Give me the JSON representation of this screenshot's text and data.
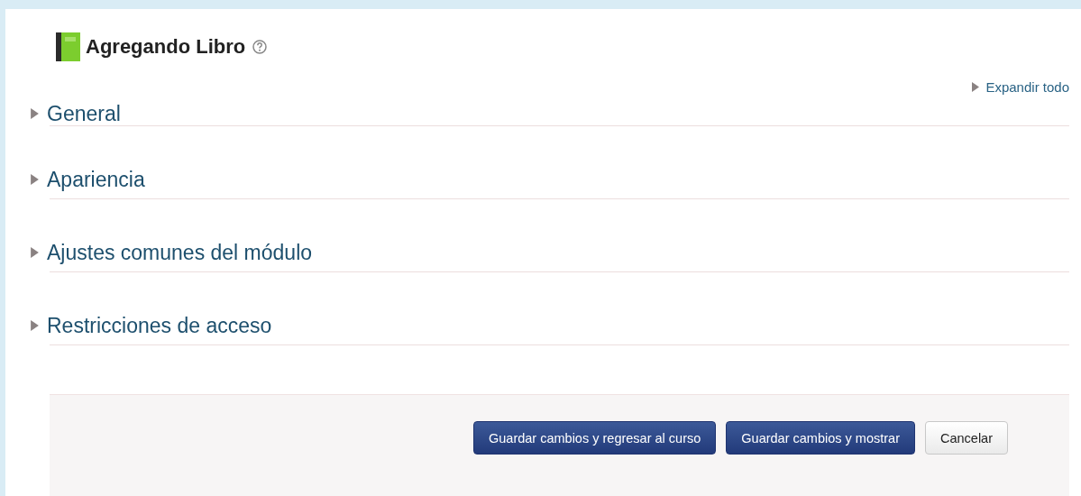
{
  "heading": {
    "title": "Agregando Libro"
  },
  "expand_all": {
    "label": "Expandir todo"
  },
  "sections": [
    {
      "title": "General",
      "expanded": false
    },
    {
      "title": "Apariencia",
      "expanded": false
    },
    {
      "title": "Ajustes comunes del módulo",
      "expanded": false
    },
    {
      "title": "Restricciones de acceso",
      "expanded": false
    }
  ],
  "buttons": [
    {
      "label": "Guardar cambios y regresar al curso",
      "kind": "primary"
    },
    {
      "label": "Guardar cambios y mostrar",
      "kind": "primary"
    },
    {
      "label": "Cancelar",
      "kind": "default"
    }
  ]
}
